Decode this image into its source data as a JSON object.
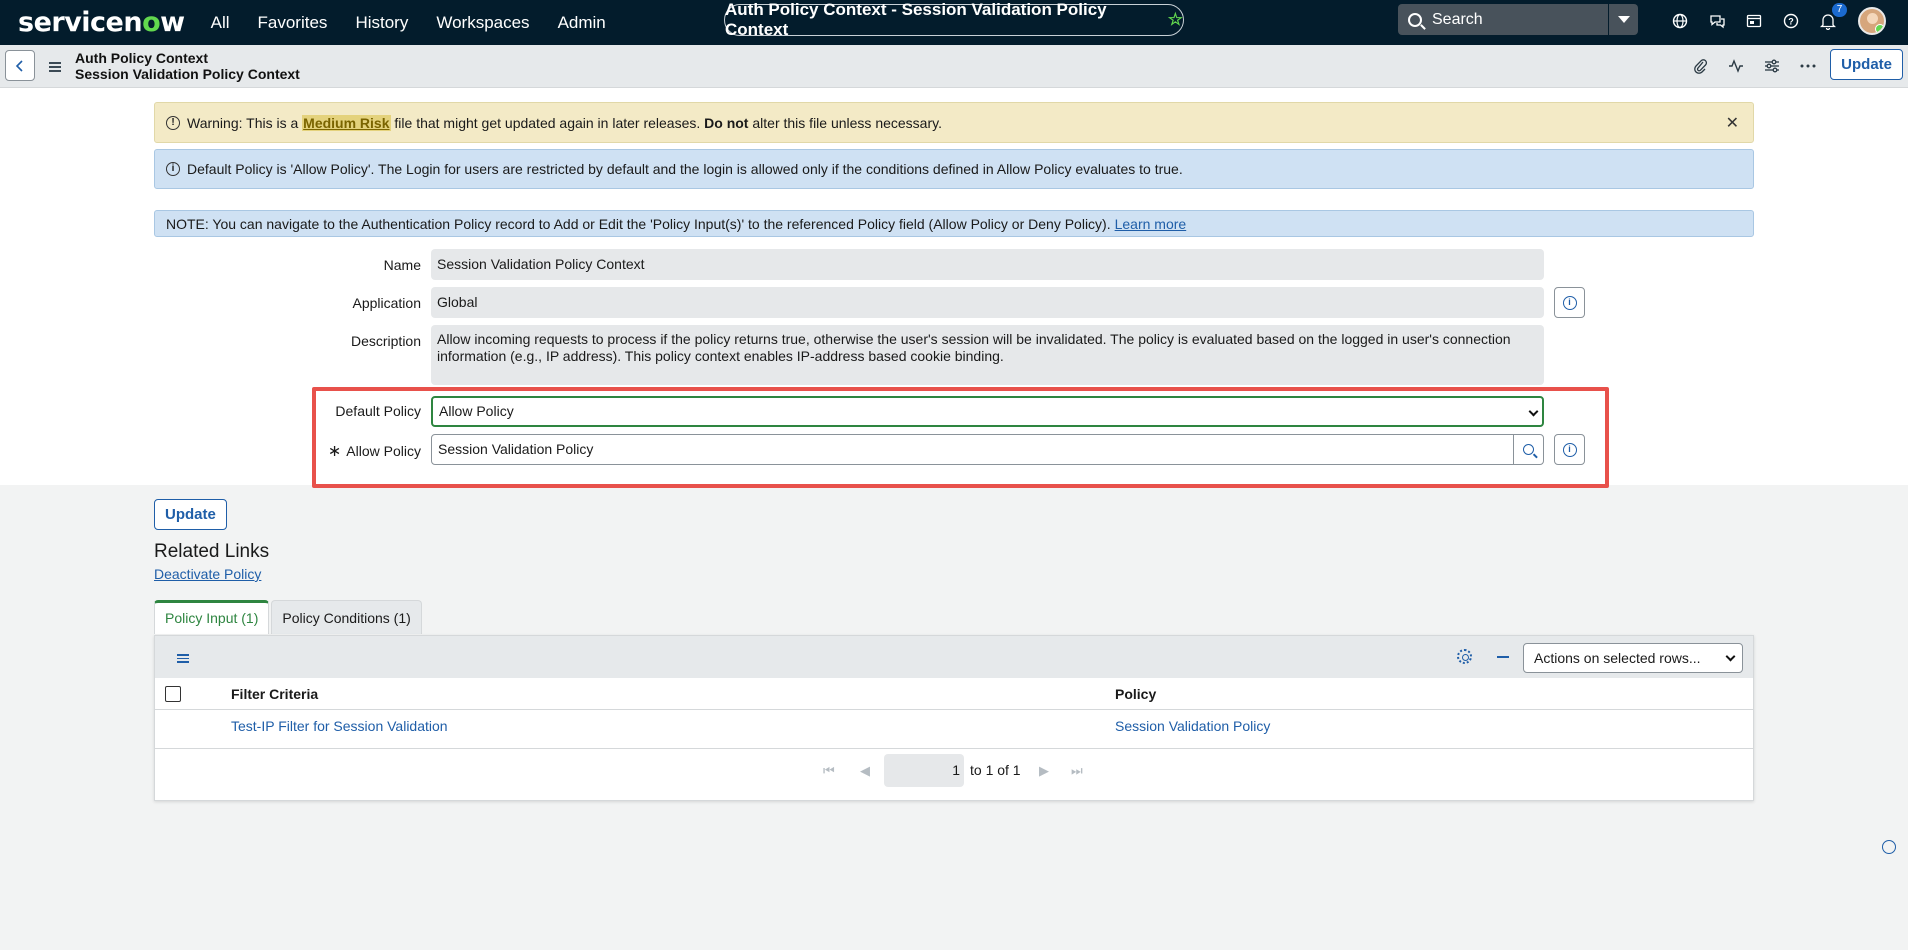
{
  "nav": {
    "logo_a": "servicen",
    "logo_o": "o",
    "logo_b": "w",
    "items": [
      "All",
      "Favorites",
      "History",
      "Workspaces",
      "Admin"
    ],
    "context_title": "Auth Policy Context - Session Validation Policy Context",
    "search_placeholder": "Search",
    "notification_count": "7"
  },
  "header": {
    "table_name": "Auth Policy Context",
    "record_name": "Session Validation Policy Context",
    "update_label": "Update"
  },
  "banners": {
    "warn_prefix": "Warning: This is a ",
    "warn_link": "Medium Risk",
    "warn_mid": " file that might get updated again in later releases. ",
    "warn_bold": "Do not",
    "warn_suffix": " alter this file unless necessary.",
    "info": "Default Policy is 'Allow Policy'. The Login for users are restricted by default and the login is allowed only if the conditions defined in Allow Policy evaluates to true.",
    "note": "NOTE: You can navigate to the Authentication Policy record to Add or Edit the 'Policy Input(s)' to the referenced Policy field (Allow Policy or Deny Policy).",
    "learn_more": "Learn more"
  },
  "form": {
    "name_label": "Name",
    "name_value": "Session Validation Policy Context",
    "application_label": "Application",
    "application_value": "Global",
    "description_label": "Description",
    "description_value": "Allow incoming requests to process if the policy returns true, otherwise the user's session will be invalidated. The policy is evaluated based on the logged in user's connection information (e.g., IP address). This policy context enables IP-address based cookie binding.",
    "default_policy_label": "Default Policy",
    "default_policy_value": "Allow Policy",
    "allow_policy_label": "Allow Policy",
    "allow_policy_value": "Session Validation Policy",
    "required_mark": "∗"
  },
  "bottom": {
    "update_label": "Update",
    "related_links": "Related Links",
    "deactivate": "Deactivate Policy"
  },
  "tabs": [
    "Policy Input (1)",
    "Policy Conditions (1)"
  ],
  "list": {
    "actions_select": "Actions on selected rows...",
    "columns": [
      "Filter Criteria",
      "Policy"
    ],
    "rows": [
      [
        "Test-IP Filter for Session Validation",
        "Session Validation Policy"
      ]
    ],
    "page_input": "1",
    "page_text": "to 1 of 1"
  }
}
